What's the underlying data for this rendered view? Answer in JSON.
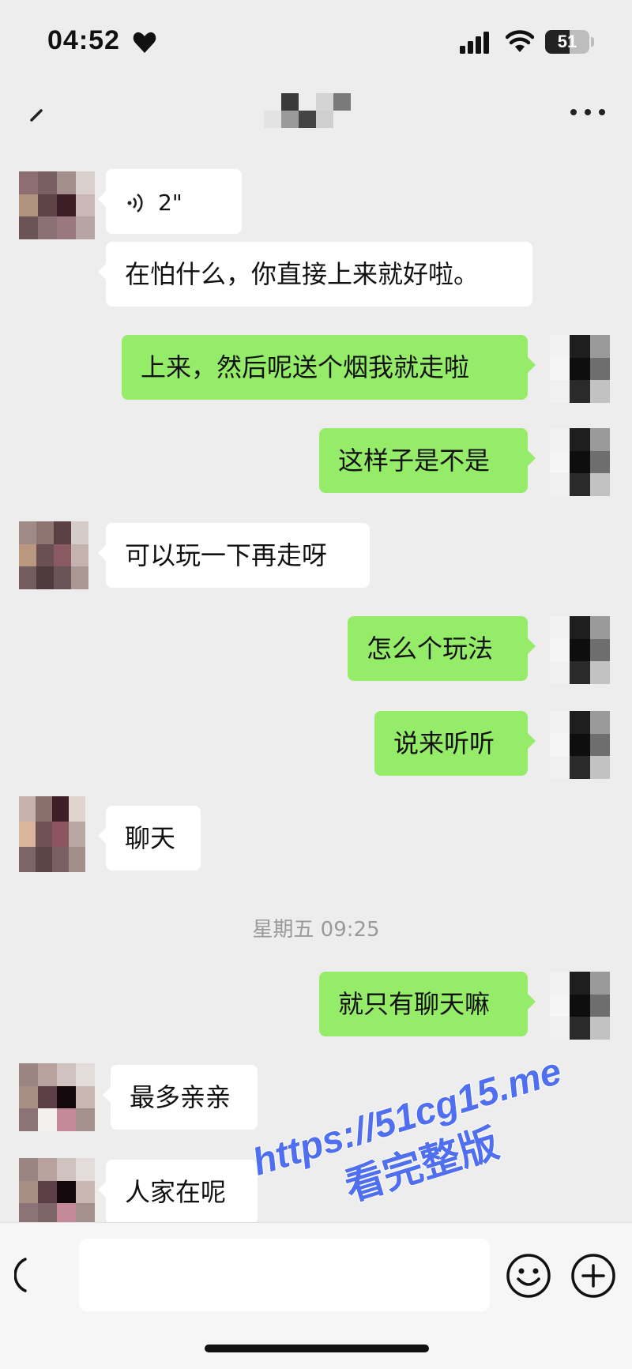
{
  "status_bar": {
    "time": "04:52",
    "heart_icon": "heart-icon",
    "signal_icon": "cellular-signal-icon",
    "wifi_icon": "wifi-icon",
    "battery_level": "51"
  },
  "nav_bar": {
    "back_icon": "back-arrow-icon",
    "title_obscured": true,
    "more_icon": "more-options-icon"
  },
  "messages": [
    {
      "side": "left",
      "type": "voice",
      "duration": "2\""
    },
    {
      "side": "left",
      "type": "text",
      "text": "在怕什么，你直接上来就好啦。"
    },
    {
      "side": "right",
      "type": "text",
      "text": "上来，然后呢送个烟我就走啦"
    },
    {
      "side": "right",
      "type": "text",
      "text": "这样子是不是"
    },
    {
      "side": "left",
      "type": "text",
      "text": "可以玩一下再走呀"
    },
    {
      "side": "right",
      "type": "text",
      "text": "怎么个玩法"
    },
    {
      "side": "right",
      "type": "text",
      "text": "说来听听"
    },
    {
      "side": "left",
      "type": "text",
      "text": "聊天"
    },
    {
      "side": "right",
      "type": "text",
      "text": "就只有聊天嘛"
    },
    {
      "side": "left",
      "type": "text",
      "text": "最多亲亲"
    },
    {
      "side": "left",
      "type": "text",
      "text": "人家在呢"
    }
  ],
  "timestamp": "星期五 09:25",
  "input_bar": {
    "voice_toggle_icon": "voice-input-icon",
    "input_value": "",
    "emoji_icon": "emoji-icon",
    "plus_icon": "plus-icon"
  },
  "watermark": {
    "url": "https://51cg15.me",
    "subtitle": "看完整版"
  },
  "colors": {
    "background": "#ededed",
    "sent_bubble": "#95ec69",
    "received_bubble": "#ffffff",
    "watermark": "#4f6ff0"
  }
}
